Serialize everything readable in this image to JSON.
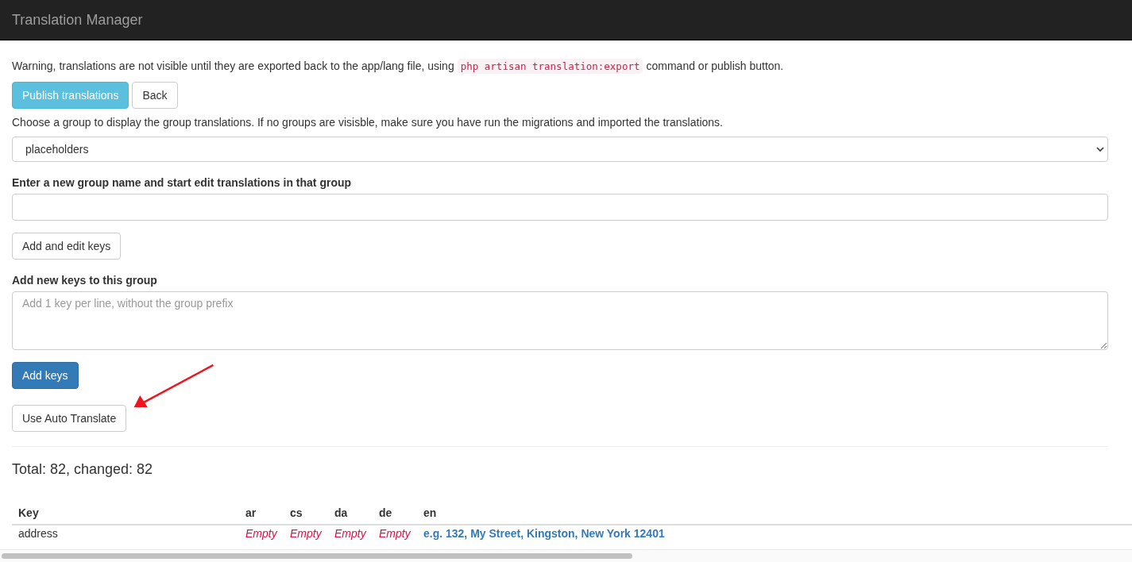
{
  "navbar": {
    "title": "Translation Manager"
  },
  "warning": {
    "before": "Warning, translations are not visible until they are exported back to the app/lang file, using",
    "code": "php artisan translation:export",
    "after": "command or publish button."
  },
  "top_buttons": [
    {
      "label": "Publish translations",
      "kind": "info"
    },
    {
      "label": "Back",
      "kind": "default"
    }
  ],
  "group_hint": "Choose a group to display the group translations. If no groups are visisble, make sure you have run the migrations and imported the translations.",
  "group_select": {
    "value": "placeholders"
  },
  "new_group": {
    "label": "Enter a new group name and start edit translations in that group",
    "button": "Add and edit keys"
  },
  "new_keys": {
    "label": "Add new keys to this group",
    "placeholder": "Add 1 key per line, without the group prefix",
    "button": "Add keys"
  },
  "auto_translate_button": "Use Auto Translate",
  "totals": "Total: 82, changed: 82",
  "table": {
    "columns": [
      "Key",
      "ar",
      "cs",
      "da",
      "de",
      "en"
    ],
    "rows": [
      {
        "cells": [
          {
            "text": "address",
            "kind": "key"
          },
          {
            "text": "Empty",
            "empty": true
          },
          {
            "text": "Empty",
            "empty": true
          },
          {
            "text": "Empty",
            "empty": true
          },
          {
            "text": "Empty",
            "empty": true
          },
          {
            "text": "e.g. 132, My Street, Kingston, New York 12401",
            "empty": false
          }
        ]
      }
    ]
  }
}
